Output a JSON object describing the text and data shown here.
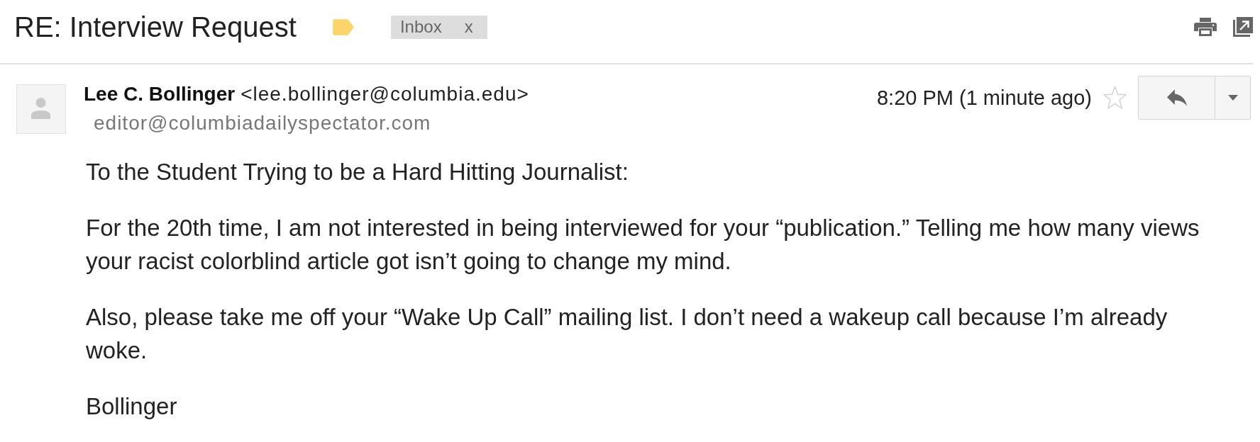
{
  "thread": {
    "subject": "RE: Interview Request",
    "important": true,
    "labels": [
      {
        "name": "Inbox",
        "remove": "x"
      }
    ]
  },
  "message": {
    "sender_name": "Lee C. Bollinger",
    "sender_email": "<lee.bollinger@columbia.edu>",
    "recipient": "editor@columbiadailyspectator.com",
    "time": "8:20 PM (1 minute ago)",
    "starred": false
  },
  "body": [
    "To the Student Trying to be a Hard Hitting Journalist:",
    "For the 20th time, I am not interested in being interviewed for your “publication.” Telling me how many views your racist colorblind article got isn’t going to change my mind.",
    "Also, please take me off your “Wake Up Call” mailing list. I don’t need a wakeup call because I’m already woke.",
    "Bollinger"
  ]
}
